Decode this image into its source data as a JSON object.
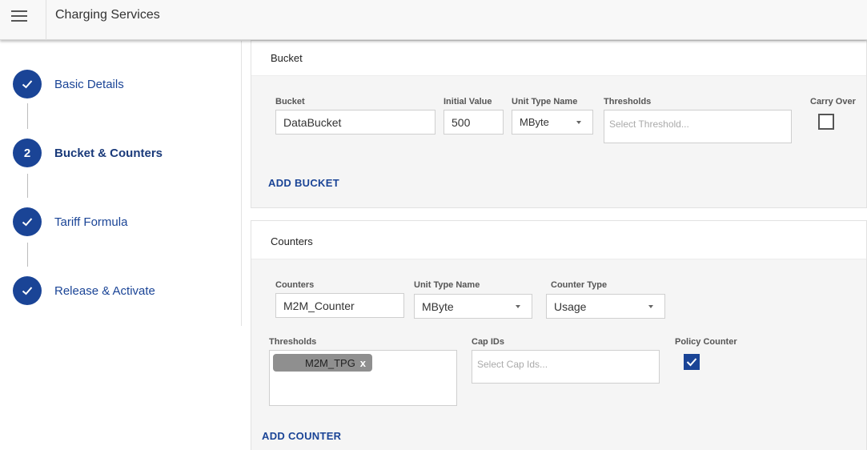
{
  "header": {
    "title": "Charging Services",
    "menu_icon": "hamburger-menu-icon"
  },
  "stepper": {
    "steps": [
      {
        "label": "Basic Details",
        "status": "done",
        "icon": "check-icon"
      },
      {
        "label": "Bucket & Counters",
        "status": "active",
        "number": "2"
      },
      {
        "label": "Tariff Formula",
        "status": "done",
        "icon": "check-icon"
      },
      {
        "label": "Release & Activate",
        "status": "done",
        "icon": "check-icon"
      }
    ],
    "accent": "#1a4496"
  },
  "bucket_section": {
    "title": "Bucket",
    "fields": {
      "bucket": {
        "label": "Bucket",
        "value": "DataBucket"
      },
      "initial_value": {
        "label": "Initial Value",
        "value": "500"
      },
      "unit_type": {
        "label": "Unit Type Name",
        "value": "MByte"
      },
      "thresholds": {
        "label": "Thresholds",
        "placeholder": "Select Threshold..."
      },
      "carry_over": {
        "label": "Carry Over",
        "checked": false
      }
    },
    "add_button": "ADD BUCKET"
  },
  "counters_section": {
    "title": "Counters",
    "fields": {
      "counters": {
        "label": "Counters",
        "value": "M2M_Counter"
      },
      "unit_type": {
        "label": "Unit Type Name",
        "value": "MByte"
      },
      "counter_type": {
        "label": "Counter Type",
        "value": "Usage"
      },
      "thresholds": {
        "label": "Thresholds",
        "chips": [
          {
            "text": "M2M_TPG",
            "remove": "x"
          }
        ]
      },
      "cap_ids": {
        "label": "Cap IDs",
        "placeholder": "Select Cap Ids..."
      },
      "policy_counter": {
        "label": "Policy Counter",
        "checked": true
      }
    },
    "add_button": "ADD COUNTER"
  }
}
